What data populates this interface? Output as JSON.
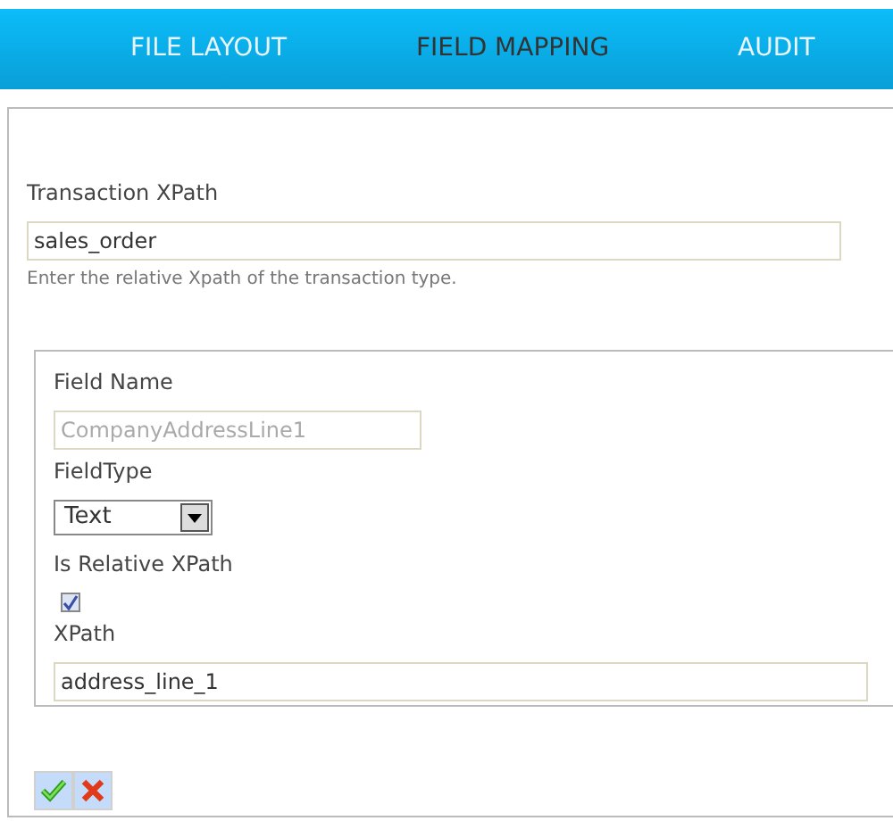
{
  "tabs": [
    {
      "label": "FILE LAYOUT",
      "selected": false
    },
    {
      "label": "FIELD MAPPING",
      "selected": true
    },
    {
      "label": "AUDIT",
      "selected": false
    }
  ],
  "transaction_xpath": {
    "label": "Transaction XPath",
    "value": "sales_order",
    "help": "Enter the relative Xpath of the transaction type."
  },
  "field": {
    "field_name": {
      "label": "Field Name",
      "value": "CompanyAddressLine1",
      "disabled": true
    },
    "field_type": {
      "label": "FieldType",
      "value": "Text"
    },
    "is_relative": {
      "label": "Is Relative XPath",
      "checked": true
    },
    "xpath": {
      "label": "XPath",
      "value": "address_line_1"
    }
  },
  "actions": [
    {
      "kind": "confirm"
    },
    {
      "kind": "cancel"
    }
  ]
}
